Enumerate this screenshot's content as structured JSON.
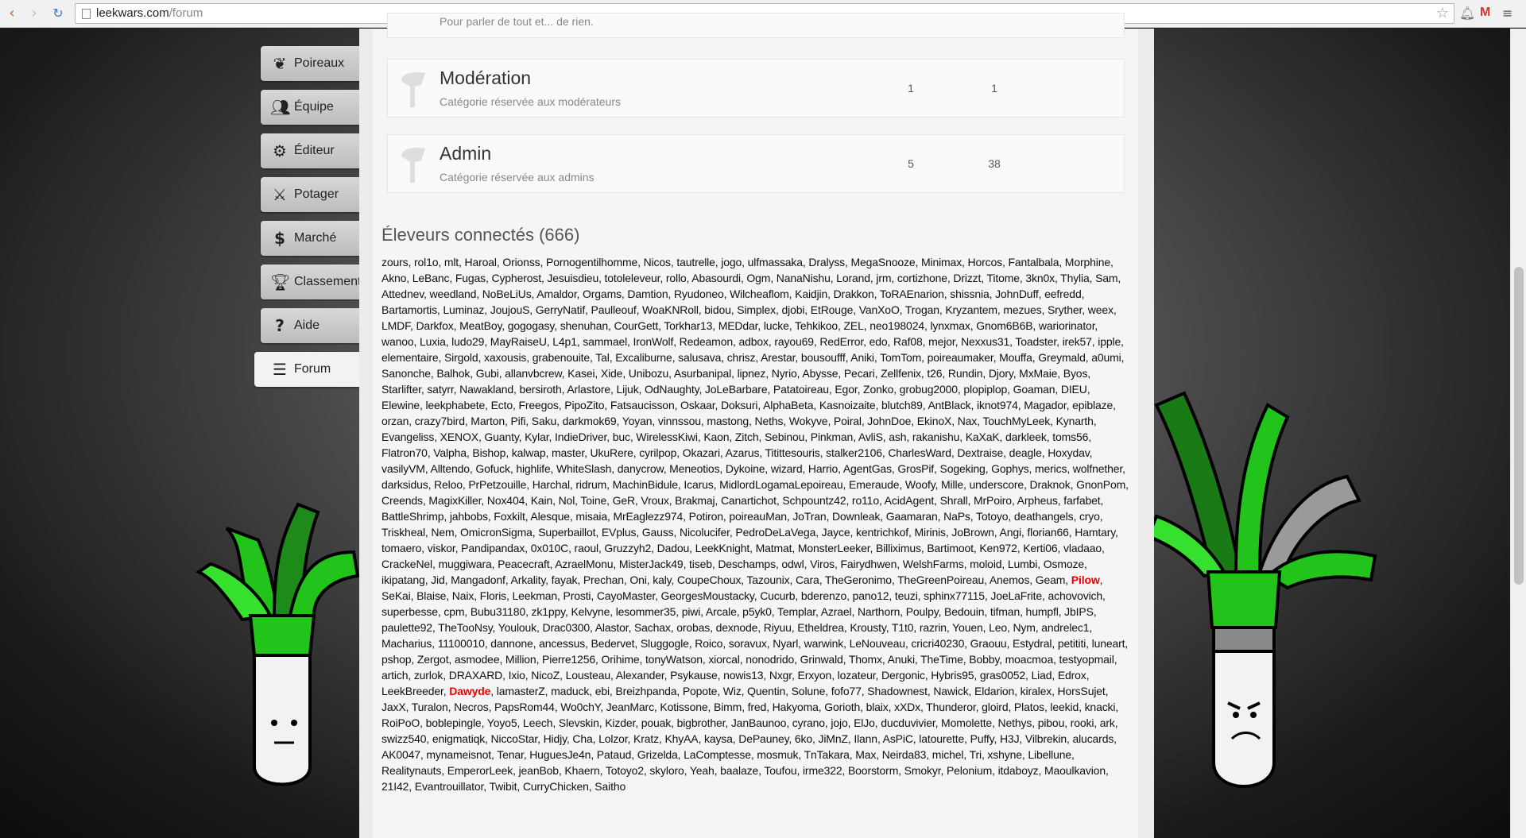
{
  "browser": {
    "url_host": "leekwars.com",
    "url_path": "/forum"
  },
  "menu": {
    "items": [
      {
        "label": "Poireaux",
        "icon": "leek-icon"
      },
      {
        "label": "Équipe",
        "icon": "team-icon"
      },
      {
        "label": "Éditeur",
        "icon": "gear-icon"
      },
      {
        "label": "Potager",
        "icon": "swords-icon"
      },
      {
        "label": "Marché",
        "icon": "dollar-icon"
      },
      {
        "label": "Classement",
        "icon": "trophy-icon"
      },
      {
        "label": "Aide",
        "icon": "question-icon"
      },
      {
        "label": "Forum",
        "icon": "list-icon"
      }
    ],
    "active": "Forum"
  },
  "categories": [
    {
      "title": "",
      "description": "Pour parler de tout et... de rien.",
      "topics": "",
      "messages": ""
    },
    {
      "title": "Modération",
      "description": "Catégorie réservée aux modérateurs",
      "topics": "1",
      "messages": "1"
    },
    {
      "title": "Admin",
      "description": "Catégorie réservée aux admins",
      "topics": "5",
      "messages": "38"
    }
  ],
  "online": {
    "title": "Éleveurs connectés (666)",
    "before_pilow": "zours, rol1o, mlt, Haroal, Orionss, Pornogentilhomme, Nicos, tautrelle, jogo, ulfmassaka, Dralyss, MegaSnooze, Minimax, Horcos, Fantalbala, Morphine, Akno, LeBanc, Fugas, Cypherost, Jesuisdieu, totoleleveur, rollo, Abasourdi, Ogm, NanaNishu, Lorand, jrm, cortizhone, Drizzt, Titome, 3kn0x, Thylia, Sam, Attednev, weedland, NoBeLiUs, Amaldor, Orgams, Damtion, Ryudoneo, Wilcheaflom, Kaidjin, Drakkon, ToRAEnarion, shissnia, JohnDuff, eefredd, Bartamortis, Luminaz, JoujouS, GerryNatif, Paulleouf, WoaKNRoll, bidou, Simplex, djobi, EtRouge, VanXoO, Trogan, Kryzantem, mezues, Sryther, weex, LMDF, Darkfox, MeatBoy, gogogasy, shenuhan, CourGett, Torkhar13, MEDdar, lucke, Tehkikoo, ZEL, neo198024, lynxmax, Gnom6B6B, wariorinator, wanoo, Luxia, ludo29, MayRaiseU, L4p1, sammael, IronWolf, Redeamon, adbox, rayou69, RedError, edo, Raf08, mejor, Nexxus31, Toadster, irek57, ipple, elementaire, Sirgold, xaxousis, grabenouite, Tal, Excaliburne, salusava, chrisz, Arestar, bousoufff, Aniki, TomTom, poireaumaker, Mouffa, Greymald, a0umi, Sanonche, Balhok, Gubi, allanvbcrew, Kasei, Xide, Unibozu, Asurbanipal, lipnez, Nyrio, Abysse, Pecari, Zellfenix, t26, Rundin, Djory, MxMaie, Byos, Starlifter, satyrr, Nawakland, bersiroth, Arlastore, Lijuk, OdNaughty, JoLeBarbare, Patatoireau, Egor, Zonko, grobug2000, plopiplop, Goaman, DIEU, Elewine, leekphabete, Ecto, Freegos, PipoZito, Fatsaucisson, Oskaar, Doksuri, AlphaBeta, Kasnoizaite, blutch89, AntBlack, iknot974, Magador, epiblaze, orzan, crazy7bird, Marton, Pifi, Saku, darkmok69, Yoyan, vinnssou, mastong, Neths, Wokyve, Poiral, JohnDoe, EkinoX, Nax, TouchMyLeek, Kynarth, Evangeliss, XENOX, Guanty, Kylar, IndieDriver, buc, WirelessKiwi, Kaon, Zitch, Sebinou, Pinkman, AvliS, ash, rakanishu, KaXaK, darkleek, toms56, Flatron70, Valpha, Bishop, kalwap, master, UkuRere, cyrilpop, Okazari, Azarus, Titittesouris, stalker2106, CharlesWard, Dextraise, deagle, Hoxydav, vasilyVM, Alltendo, Gofuck, highlife, WhiteSlash, danycrow, Meneotios, Dykoine, wizard, Harrio, AgentGas, GrosPif, Sogeking, Gophys, merics, wolfnether, darksidus, Reloo, PrPetzouille, Harchal, ridrum, MachinBidule, Icarus, MidlordLogamaLepoireau, Emeraude, Woofy, Mille, underscore, Draknok, GnonPom, Creends, MagixKiller, Nox404, Kain, Nol, Toine, GeR, Vroux, Brakmaj, Canartichot, Schpountz42, ro11o, AcidAgent, Shrall, MrPoiro, Arpheus, farfabet, BattleShrimp, jahbobs, Foxkilt, Alesque, misaia, MrEaglezz974, Potiron, poireauMan, JoTran, Downleak, Gaamaran, NaPs, Totoyo, deathangels, cryo, Triskheal, Nem, OmicronSigma, Superbaillot, EVplus, Gauss, Nicolucifer, PedroDeLaVega, Jayce, kentrichkof, Mirinis, JoBrown, Angi, florian66, Hamtary, tomaero, viskor, Pandipandax, 0x010C, raoul, Gruzzyh2, Dadou, LeekKnight, Matmat, MonsterLeeker, Billiximus, Bartimoot, Ken972, Kerti06, vladaao, CrackeNel, muggiwara, Peacecraft, AzraelMonu, MisterJack49, tiseb, Deschamps, odwl, Viros, Fairydhwen, WelshFarms, moloid, Lumbi, Osmoze, ikipatang, Jid, Mangadonf, Arkality, fayak, Prechan, Oni, kaly, CoupeChoux, Tazounix, Cara, TheGeronimo, TheGreenPoireau, Anemos, Geam, ",
    "pilow": "Pilow",
    "between": ", SeKai, Blaise, Naix, Floris, Leekman, Prosti, CayoMaster, GeorgesMoustacky, Cucurb, bderenzo, pano12, teuzi, sphinx77115, JoeLaFrite, achovovich, superbesse, cpm, Bubu31180, zk1ppy, Kelvyne, lesommer35, piwi, Arcale, p5yk0, Templar, Azrael, Narthorn, Poulpy, Bedouin, tifman, humpfl, JbIPS, paulette92, TheTooNsy, Youlouk, Drac0300, Alastor, Sachax, orobas, dexnode, Riyuu, Etheldrea, Krousty, T1t0, razrin, Youen, Leo, Nym, andrelec1, Macharius, 11100010, dannone, ancessus, Bedervet, Sluggogle, Roico, soravux, Nyarl, warwink, LeNouveau, cricri40230, Graouu, Estydral, petititi, luneart, pshop, Zergot, asmodee, Million, Pierre1256, Orihime, tonyWatson, xiorcal, nonodrido, Grinwald, Thomx, Anuki, TheTime, Bobby, moacmoa, testyopmail, artich, zurlok, DRAXARD, Ixio, NicoZ, Lousteau, Alexander, Psykause, nowis13, Nxgr, Erxyon, lozateur, Dergonic, Hybris95, gras0052, Liad, Edrox, LeekBreeder, ",
    "dawyde": "Dawyde",
    "after_dawyde": ", lamasterZ, maduck, ebi, Breizhpanda, Popote, Wiz, Quentin, Solune, fofo77, Shadownest, Nawick, Eldarion, kiralex, HorsSujet, JaxX, Turalon, Necros, PapsRom44, Wo0chY, JeanMarc, Kotissone, Bimm, fred, Hakyoma, Gorioth, blaix, xXDx, Thunderor, gloird, Platos, leekid, knacki, RoiPoO, boblepingle, Yoyo5, Leech, Slevskin, Kizder, pouak, bigbrother, JanBaunoo, cyrano, jojo, ElJo, ducduvivier, Momolette, Nethys, pibou, rooki, ark, swizz540, enigmatiqk, NiccoStar, Hidjy, Cha, Lolzor, Kratz, KhyAA, kaysa, DePauney, 6ko, JiMnZ, Ilann, AsPiC, latourette, Puffy, H3J, Vilbrekin, alucards, AK0047, mynameisnot, Tenar, HuguesJe4n, Pataud, Grizelda, LaComptesse, mosmuk, TnTakara, Max, Neirda83, michel, Tri, xshyne, Libellune, Realitynauts, EmperorLeek, jeanBob, Khaern, Totoyo2, skyloro, Yeah, baalaze, Toufou, irme322, Boorstorm, Smokyr, Pelonium, itdaboyz, Maoulkavion, 21I42, Evantrouillator, Twibit, CurryChicken, Saitho"
  },
  "colors": {
    "moderator_name": "#e00000",
    "leek_green": "#22c41c",
    "panel_bg": "#f5f5f5"
  }
}
